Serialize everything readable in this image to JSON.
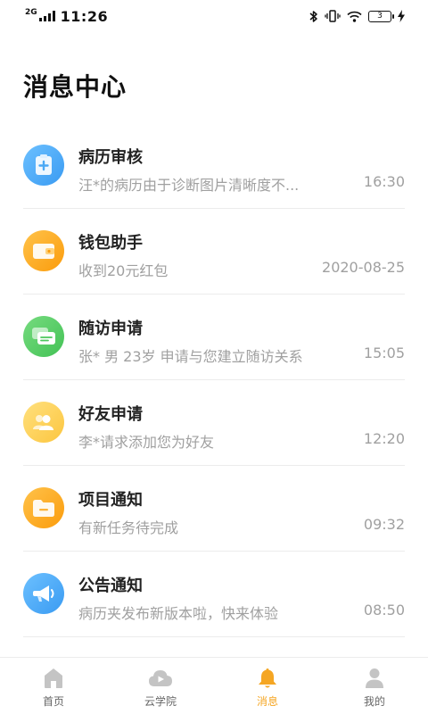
{
  "status_bar": {
    "network": "2G",
    "time": "11:26",
    "battery": "3"
  },
  "page": {
    "title": "消息中心"
  },
  "messages": [
    {
      "title": "病历审核",
      "preview": "汪*的病历由于诊断图片清晰度不...",
      "time": "16:30",
      "icon": "clipboard-plus-icon",
      "color_from": "#6cc0ff",
      "color_to": "#3a9bf2"
    },
    {
      "title": "钱包助手",
      "preview": "收到20元红包",
      "time": "2020-08-25",
      "icon": "wallet-icon",
      "color_from": "#ffc24a",
      "color_to": "#fb9c0c"
    },
    {
      "title": "随访申请",
      "preview": "张* 男 23岁 申请与您建立随访关系",
      "time": "15:05",
      "icon": "chat-bubbles-icon",
      "color_from": "#76db7f",
      "color_to": "#43c255"
    },
    {
      "title": "好友申请",
      "preview": "李*请求添加您为好友",
      "time": "12:20",
      "icon": "users-icon",
      "color_from": "#ffe07e",
      "color_to": "#fcc63f"
    },
    {
      "title": "项目通知",
      "preview": "有新任务待完成",
      "time": "09:32",
      "icon": "folder-icon",
      "color_from": "#ffc24a",
      "color_to": "#fb9c0c"
    },
    {
      "title": "公告通知",
      "preview": "病历夹发布新版本啦，快来体验",
      "time": "08:50",
      "icon": "megaphone-icon",
      "color_from": "#6cc0ff",
      "color_to": "#3a9bf2"
    }
  ],
  "tabs": [
    {
      "label": "首页",
      "icon": "home-icon",
      "active": false
    },
    {
      "label": "云学院",
      "icon": "cloud-play-icon",
      "active": false
    },
    {
      "label": "消息",
      "icon": "bell-icon",
      "active": true
    },
    {
      "label": "我的",
      "icon": "person-icon",
      "active": false
    }
  ],
  "colors": {
    "accent": "#f5a623",
    "tab_inactive": "#c4c4c4",
    "muted_text": "#a0a0a0"
  }
}
